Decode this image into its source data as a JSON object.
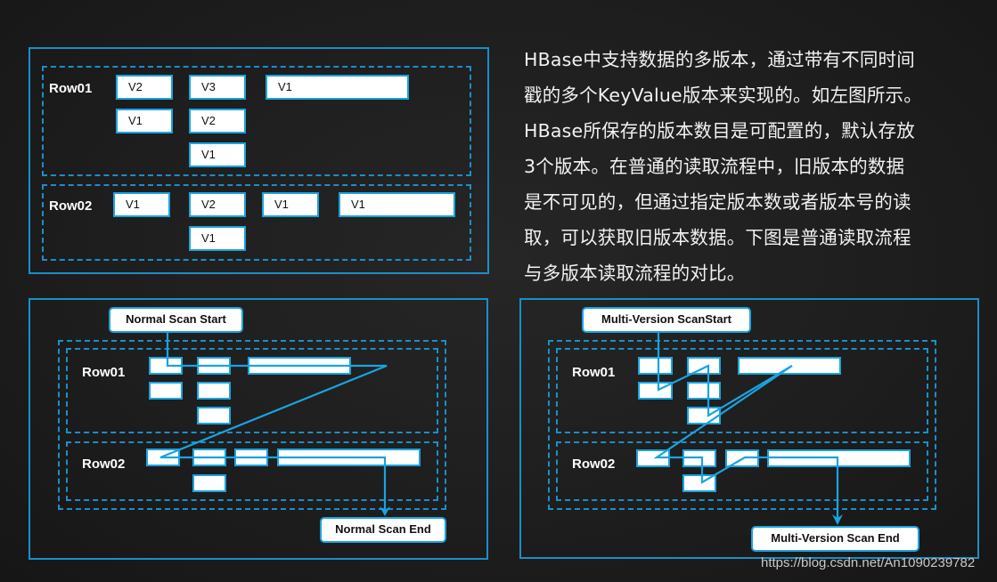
{
  "colors": {
    "border": "#1a8fc8",
    "flow_line": "#1aa3e0",
    "cell_fill": "#ffffff",
    "text_light": "#f2f2f2"
  },
  "version_diagram": {
    "rows": [
      {
        "label": "Row01",
        "cells": [
          {
            "column": 1,
            "versions": [
              "V2",
              "V1"
            ]
          },
          {
            "column": 2,
            "versions": [
              "V3",
              "V2",
              "V1"
            ]
          },
          {
            "column": 3,
            "versions": [
              "V1"
            ]
          }
        ]
      },
      {
        "label": "Row02",
        "cells": [
          {
            "column": 1,
            "versions": [
              "V1"
            ]
          },
          {
            "column": 2,
            "versions": [
              "V2",
              "V1"
            ]
          },
          {
            "column": 3,
            "versions": [
              "V1"
            ]
          },
          {
            "column": 4,
            "versions": [
              "V1"
            ]
          }
        ]
      }
    ]
  },
  "description": "HBase中支持数据的多版本，通过带有不同时间戳的多个KeyValue版本来实现的。如左图所示。HBase所保存的版本数目是可配置的，默认存放3个版本。在普通的读取流程中，旧版本的数据是不可见的，但通过指定版本数或者版本号的读取，可以获取旧版本数据。下图是普通读取流程与多版本读取流程的对比。",
  "description_lines": [
    "HBase中支持数据的多版本，通过带有不同时间",
    "戳的多个KeyValue版本来实现的。如左图所示。",
    "HBase所保存的版本数目是可配置的，默认存放",
    "3个版本。在普通的读取流程中，旧版本的数据",
    "是不可见的，但通过指定版本数或者版本号的读",
    "取，可以获取旧版本数据。下图是普通读取流程",
    "与多版本读取流程的对比。"
  ],
  "normal_scan": {
    "start_label": "Normal Scan Start",
    "end_label": "Normal Scan End",
    "row_labels": [
      "Row01",
      "Row02"
    ],
    "visits": "latest version of each column only"
  },
  "multi_version_scan": {
    "start_label": "Multi-Version ScanStart",
    "end_label": "Multi-Version Scan End",
    "row_labels": [
      "Row01",
      "Row02"
    ],
    "visits": "all versions of each column"
  },
  "watermark": "https://blog.csdn.net/An1090239782"
}
